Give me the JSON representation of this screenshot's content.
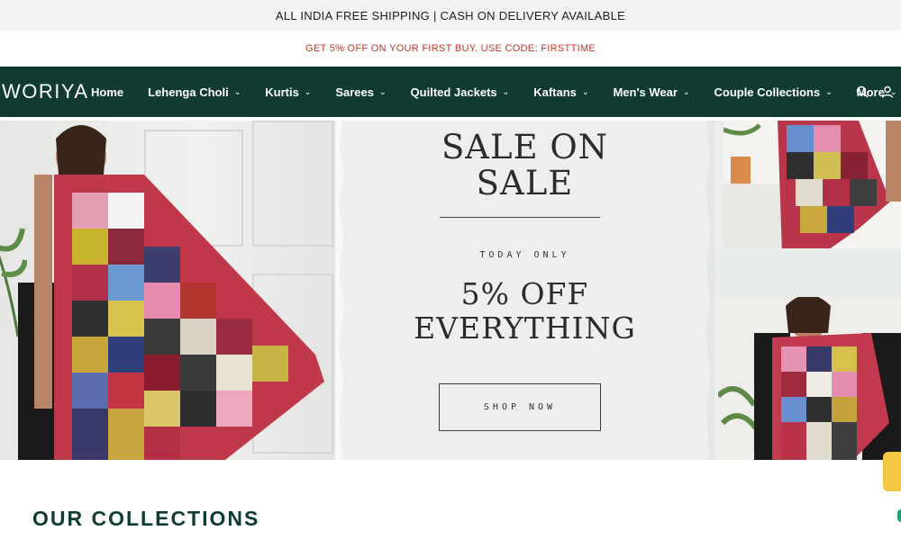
{
  "announcement_bar": {
    "shipping_text": "ALL INDIA FREE SHIPPING | CASH ON DELIVERY AVAILABLE",
    "promo_text": "GET 5% OFF ON YOUR FIRST BUY. USE CODE: FIRSTTIME"
  },
  "header": {
    "logo": "WORIYA",
    "nav": [
      {
        "label": "Home",
        "has_dropdown": false
      },
      {
        "label": "Lehenga Choli",
        "has_dropdown": true
      },
      {
        "label": "Kurtis",
        "has_dropdown": true
      },
      {
        "label": "Sarees",
        "has_dropdown": true
      },
      {
        "label": "Quilted Jackets",
        "has_dropdown": true
      },
      {
        "label": "Kaftans",
        "has_dropdown": true
      },
      {
        "label": "Men's Wear",
        "has_dropdown": true
      },
      {
        "label": "Couple Collections",
        "has_dropdown": true
      },
      {
        "label": "More",
        "has_dropdown": true
      }
    ],
    "icons": [
      "search-icon",
      "account-icon"
    ]
  },
  "hero": {
    "title": "SALE ON SALE",
    "subtitle": "TODAY ONLY",
    "offer": "5% OFF EVERYTHING",
    "cta": "SHOP NOW"
  },
  "collections": {
    "title": "OUR COLLECTIONS"
  },
  "colors": {
    "nav_bg": "#0f3b33",
    "promo_text": "#c0392b",
    "announce_bg": "#f3f3f3",
    "card_bg": "#efeeec"
  }
}
